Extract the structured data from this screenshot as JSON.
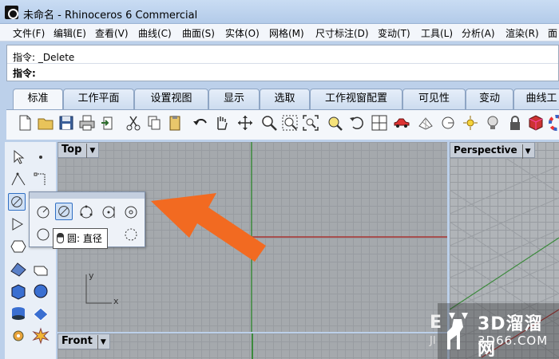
{
  "window": {
    "title": "未命名 - Rhinoceros 6 Commercial"
  },
  "menu": [
    "文件(F)",
    "编辑(E)",
    "查看(V)",
    "曲线(C)",
    "曲面(S)",
    "实体(O)",
    "网格(M)",
    "尺寸标注(D)",
    "变动(T)",
    "工具(L)",
    "分析(A)",
    "渲染(R)",
    "面"
  ],
  "command": {
    "history_label": "指令:",
    "history_value": "_Delete",
    "prompt_label": "指令:"
  },
  "tabs": [
    "标准",
    "工作平面",
    "设置视图",
    "显示",
    "选取",
    "工作视窗配置",
    "可见性",
    "变动",
    "曲线工"
  ],
  "active_tab": 0,
  "toolbar_icons": [
    "new-file-icon",
    "open-folder-icon",
    "save-icon",
    "print-icon",
    "import-icon",
    "cut-icon",
    "copy-icon",
    "paste-icon",
    "undo-icon",
    "pan-hand-icon",
    "rotate-view-icon",
    "zoom-icon",
    "zoom-window-icon",
    "zoom-extents-icon",
    "zoom-selected-icon",
    "rotate-icon",
    "four-viewports-icon",
    "car-render-icon",
    "grid-icon",
    "circle-icon",
    "light-icon",
    "bulb-icon",
    "lock-icon",
    "material-icon",
    "color-wheel-icon"
  ],
  "viewports": {
    "top": {
      "label": "Top"
    },
    "perspective": {
      "label": "Perspective"
    },
    "front": {
      "label": "Front"
    }
  },
  "axes": {
    "x": "x",
    "y": "y"
  },
  "tooltip": {
    "text": "圆: 直径"
  },
  "watermark": {
    "brand": "3D溜溜网",
    "domain": "3D66.COM",
    "partial": "E",
    "partial2": "JI"
  },
  "colors": {
    "arrow": "#f26a21",
    "x_axis": "#a83232",
    "y_axis": "#3c8a3c",
    "accent": "#2f6fc4"
  }
}
